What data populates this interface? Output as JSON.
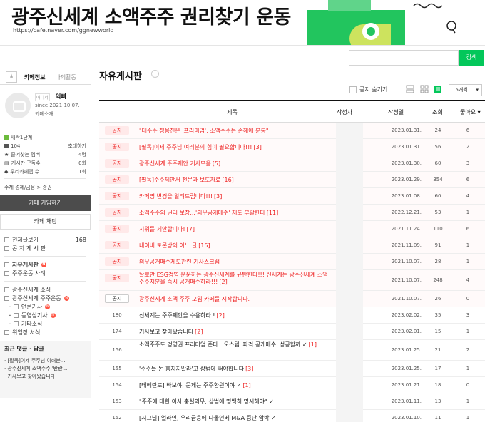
{
  "banner": {
    "title": "광주신세계 소액주주 권리찾기 운동",
    "url": "https://cafe.naver.com/ggnewworld"
  },
  "search": {
    "placeholder": "",
    "button_label": "검색"
  },
  "sidebar": {
    "tabs": [
      "카페정보",
      "나의활동"
    ],
    "profile": {
      "role": "매니저",
      "nickname": "익삐",
      "since": "since 2021.10.07.",
      "intro": "카페소개"
    },
    "stats": [
      {
        "label": "새싹1단계",
        "value": ""
      },
      {
        "label": "104",
        "value": "초대하기"
      },
      {
        "label": "즐겨찾는 멤버",
        "value": "4명"
      },
      {
        "label": "게시판 구독수",
        "value": "0회"
      },
      {
        "label": "우리카페앱 수",
        "value": "1회"
      }
    ],
    "subject": "주제 경제/금융 > 증권",
    "join_label": "카페 가입하기",
    "chat_label": "카페 채팅",
    "menu_top": [
      {
        "label": "전체글보기",
        "count": "168"
      },
      {
        "label": "공 지 게 시 판",
        "count": ""
      }
    ],
    "menu_mid": [
      {
        "label": "자유게시판",
        "badge": "N"
      },
      {
        "label": "주주운동 사례",
        "badge": ""
      }
    ],
    "menu_bottom": [
      {
        "label": "광주신세계 소식",
        "badge": ""
      },
      {
        "label": "광주신세계 주주운동",
        "badge": "N"
      },
      {
        "label": "언론기사",
        "badge": "N"
      },
      {
        "label": "동영상기사",
        "badge": "N"
      },
      {
        "label": "기타소식",
        "badge": ""
      },
      {
        "label": "위임장 서식",
        "badge": ""
      }
    ],
    "recent_title": "최근 댓글 · 답글",
    "recent_items": [
      "[필독]이제 주주님 여러분...",
      "광주신세계 소액주주 '반란...",
      "기사보고 찾아왔습니다"
    ]
  },
  "board": {
    "title": "자유게시판",
    "notice_toggle_label": "공지 숨기기",
    "per_page": "15개씩",
    "columns": {
      "title": "제목",
      "author": "작성자",
      "date": "작성일",
      "views": "조회",
      "likes": "좋아요 ▾"
    },
    "notice_label": "공지",
    "rows": [
      {
        "type": "notice",
        "title": "\"대주주 정용진은 '프리미엄', 소액주주는 손해에 분통\"",
        "comments": "",
        "date": "2023.01.31.",
        "views": "24",
        "likes": "6"
      },
      {
        "type": "notice",
        "title": "[필독]이제 주주님 여러분의 힘이 필요합니다!!!",
        "comments": "[3]",
        "date": "2023.01.31.",
        "views": "56",
        "likes": "2"
      },
      {
        "type": "notice",
        "title": "광주신세계 주주제안 기사모음",
        "comments": "[5]",
        "date": "2023.01.30.",
        "views": "60",
        "likes": "3"
      },
      {
        "type": "notice",
        "title": "[필독]주주제안서 전문과 보도자료",
        "comments": "[16]",
        "date": "2023.01.29.",
        "views": "354",
        "likes": "6"
      },
      {
        "type": "notice",
        "title": "카페명 변경을 알려드립니다!!!",
        "comments": "[3]",
        "date": "2023.01.08.",
        "views": "60",
        "likes": "4"
      },
      {
        "type": "notice",
        "title": "소액주주의 권리 보장...'의무공개매수' 제도 부활한다",
        "comments": "[11]",
        "date": "2022.12.21.",
        "views": "53",
        "likes": "1"
      },
      {
        "type": "notice",
        "title": "시위를 제안합니다!",
        "comments": "[7]",
        "date": "2021.11.24.",
        "views": "110",
        "likes": "6"
      },
      {
        "type": "notice",
        "title": "네이버 토론방의 어느 글",
        "comments": "[15]",
        "date": "2021.11.09.",
        "views": "91",
        "likes": "1"
      },
      {
        "type": "notice",
        "title": "의무공개매수제도관련 기사스크랩",
        "comments": "",
        "date": "2021.10.07.",
        "views": "28",
        "likes": "1"
      },
      {
        "type": "notice2",
        "title": "탈로만 ESG경영 운운하는 광주신세계를 규탄한다!!! 신세계는 광주신세계 소액주주지분을 즉시 공개매수하라!!!",
        "comments": "[2]",
        "date": "2021.10.07.",
        "views": "248",
        "likes": "4"
      },
      {
        "type": "notice-outline",
        "title": "광주신세계 소액 주주 모임 카페를 시작합니다.",
        "comments": "",
        "date": "2021.10.07.",
        "views": "26",
        "likes": "0"
      },
      {
        "type": "normal",
        "num": "180",
        "title": "신세계는 주주제안을 수용하라 !",
        "comments": "[2]",
        "date": "2023.02.02.",
        "views": "35",
        "likes": "3"
      },
      {
        "type": "normal",
        "num": "174",
        "title": "기사보고 찾아왔습니다",
        "comments": "[2]",
        "date": "2023.02.01.",
        "views": "15",
        "likes": "1"
      },
      {
        "type": "normal2",
        "num": "156",
        "title": "소액주주도 경영권 프리미엄 준다…오스템 '파격 공개매수' 성공할까 ✓",
        "comments": "[1]",
        "date": "2023.01.25.",
        "views": "21",
        "likes": "2"
      },
      {
        "type": "normal",
        "num": "155",
        "title": "'주주들 돈 훔치지말라'고 상법에 써야합니다",
        "comments": "[3]",
        "date": "2023.01.25.",
        "views": "17",
        "likes": "1"
      },
      {
        "type": "normal",
        "num": "154",
        "title": "[테헤란로] 바보야, 문제는 주주환원이야 ✓",
        "comments": "[1]",
        "date": "2023.01.21.",
        "views": "18",
        "likes": "0"
      },
      {
        "type": "normal",
        "num": "153",
        "title": "\"주주에 대한 이사 충실의무, 상법에 명백히 명시해야\" ✓",
        "comments": "",
        "date": "2023.01.11.",
        "views": "13",
        "likes": "1"
      },
      {
        "type": "normal",
        "num": "152",
        "title": "[시그널] 얼라인, 우리금융에 다올인베 M&A 중단 압박 ✓",
        "comments": "",
        "date": "2023.01.10.",
        "views": "11",
        "likes": "1"
      }
    ]
  },
  "colors": {
    "accent_green": "#03c75a",
    "notice_red": "#e22",
    "dark_button": "#4c4c4c"
  }
}
